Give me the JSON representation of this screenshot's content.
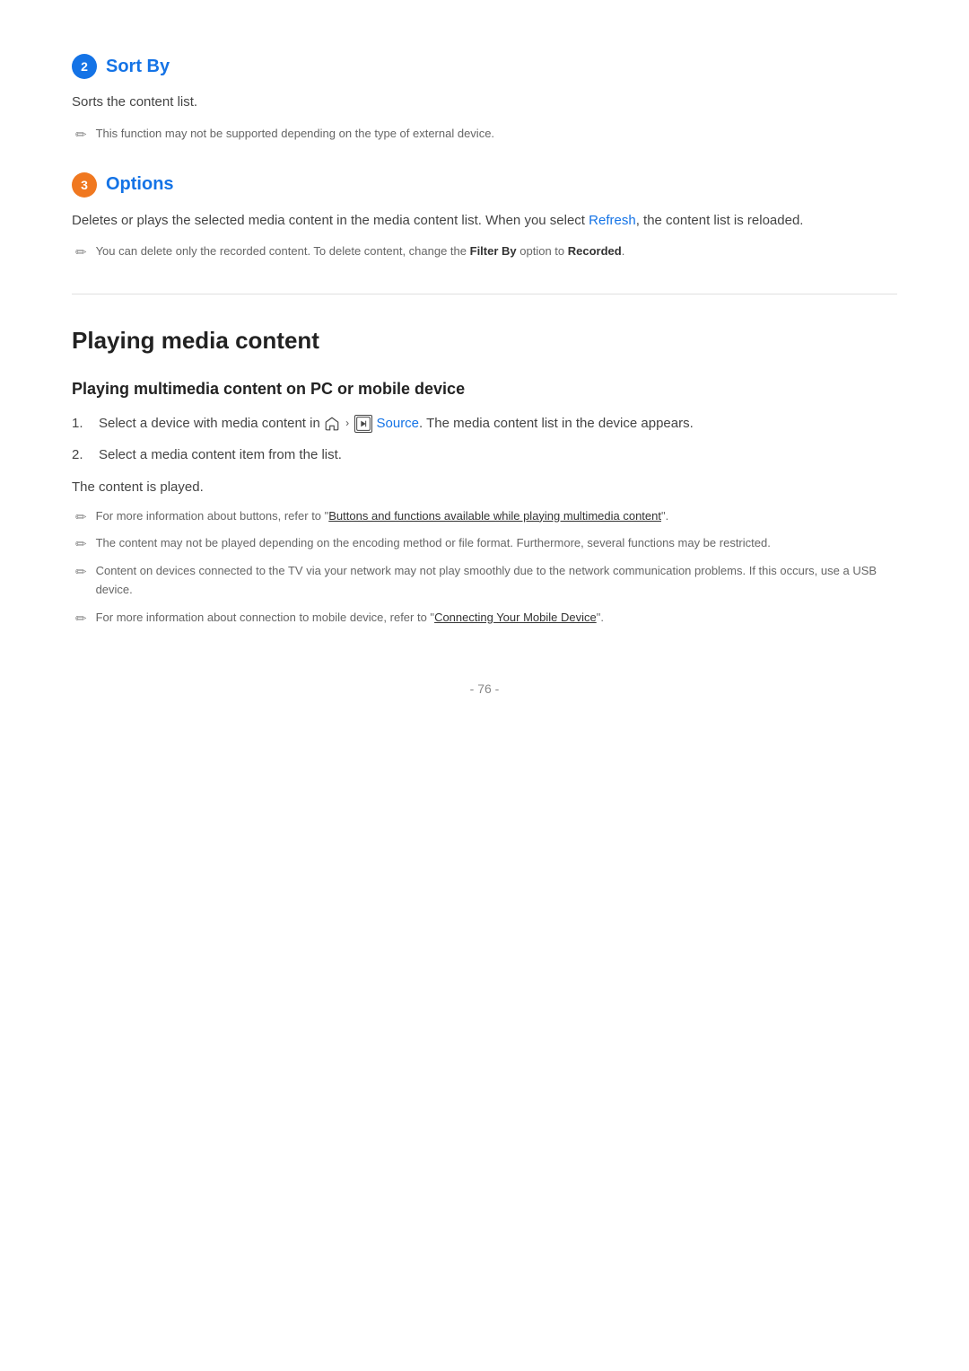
{
  "sections": [
    {
      "id": "sort-by",
      "badge": "2",
      "badge_color": "blue",
      "title": "Sort By",
      "body": "Sorts the content list.",
      "notes": [
        {
          "text": "This function may not be supported depending on the type of external device."
        }
      ]
    },
    {
      "id": "options",
      "badge": "3",
      "badge_color": "orange",
      "title": "Options",
      "body_parts": [
        {
          "text": "Deletes or plays the selected media content in the media content list. When you select "
        },
        {
          "text": "Refresh",
          "type": "blue"
        },
        {
          "text": ", the content list is reloaded."
        }
      ],
      "notes": [
        {
          "parts": [
            {
              "text": "You can delete only the recorded content. To delete content, change the "
            },
            {
              "text": "Filter By",
              "type": "bold"
            },
            {
              "text": " option to "
            },
            {
              "text": "Recorded",
              "type": "bold"
            },
            {
              "text": "."
            }
          ]
        }
      ]
    }
  ],
  "playing_section": {
    "title": "Playing media content",
    "subsection_title": "Playing multimedia content on PC or mobile device",
    "steps": [
      {
        "number": "1.",
        "parts": [
          {
            "text": "Select a device with media content in "
          },
          {
            "type": "home-icon"
          },
          {
            "text": " > "
          },
          {
            "type": "source-icon"
          },
          {
            "text": " Source. The media content list in the device appears."
          }
        ]
      },
      {
        "number": "2.",
        "text": "Select a media content item from the list."
      }
    ],
    "content_played_label": "The content is played.",
    "notes": [
      {
        "parts": [
          {
            "text": "For more information about buttons, refer to \""
          },
          {
            "text": "Buttons and functions available while playing multimedia content",
            "type": "underline"
          },
          {
            "text": "\"."
          }
        ]
      },
      {
        "text": "The content may not be played depending on the encoding method or file format. Furthermore, several functions may be restricted."
      },
      {
        "text": "Content on devices connected to the TV via your network may not play smoothly due to the network communication problems. If this occurs, use a USB device."
      },
      {
        "parts": [
          {
            "text": "For more information about connection to mobile device, refer to \""
          },
          {
            "text": "Connecting Your Mobile Device",
            "type": "underline"
          },
          {
            "text": "\"."
          }
        ]
      }
    ]
  },
  "footer": {
    "page": "- 76 -"
  },
  "icons": {
    "pencil": "✏",
    "chevron": "›"
  }
}
